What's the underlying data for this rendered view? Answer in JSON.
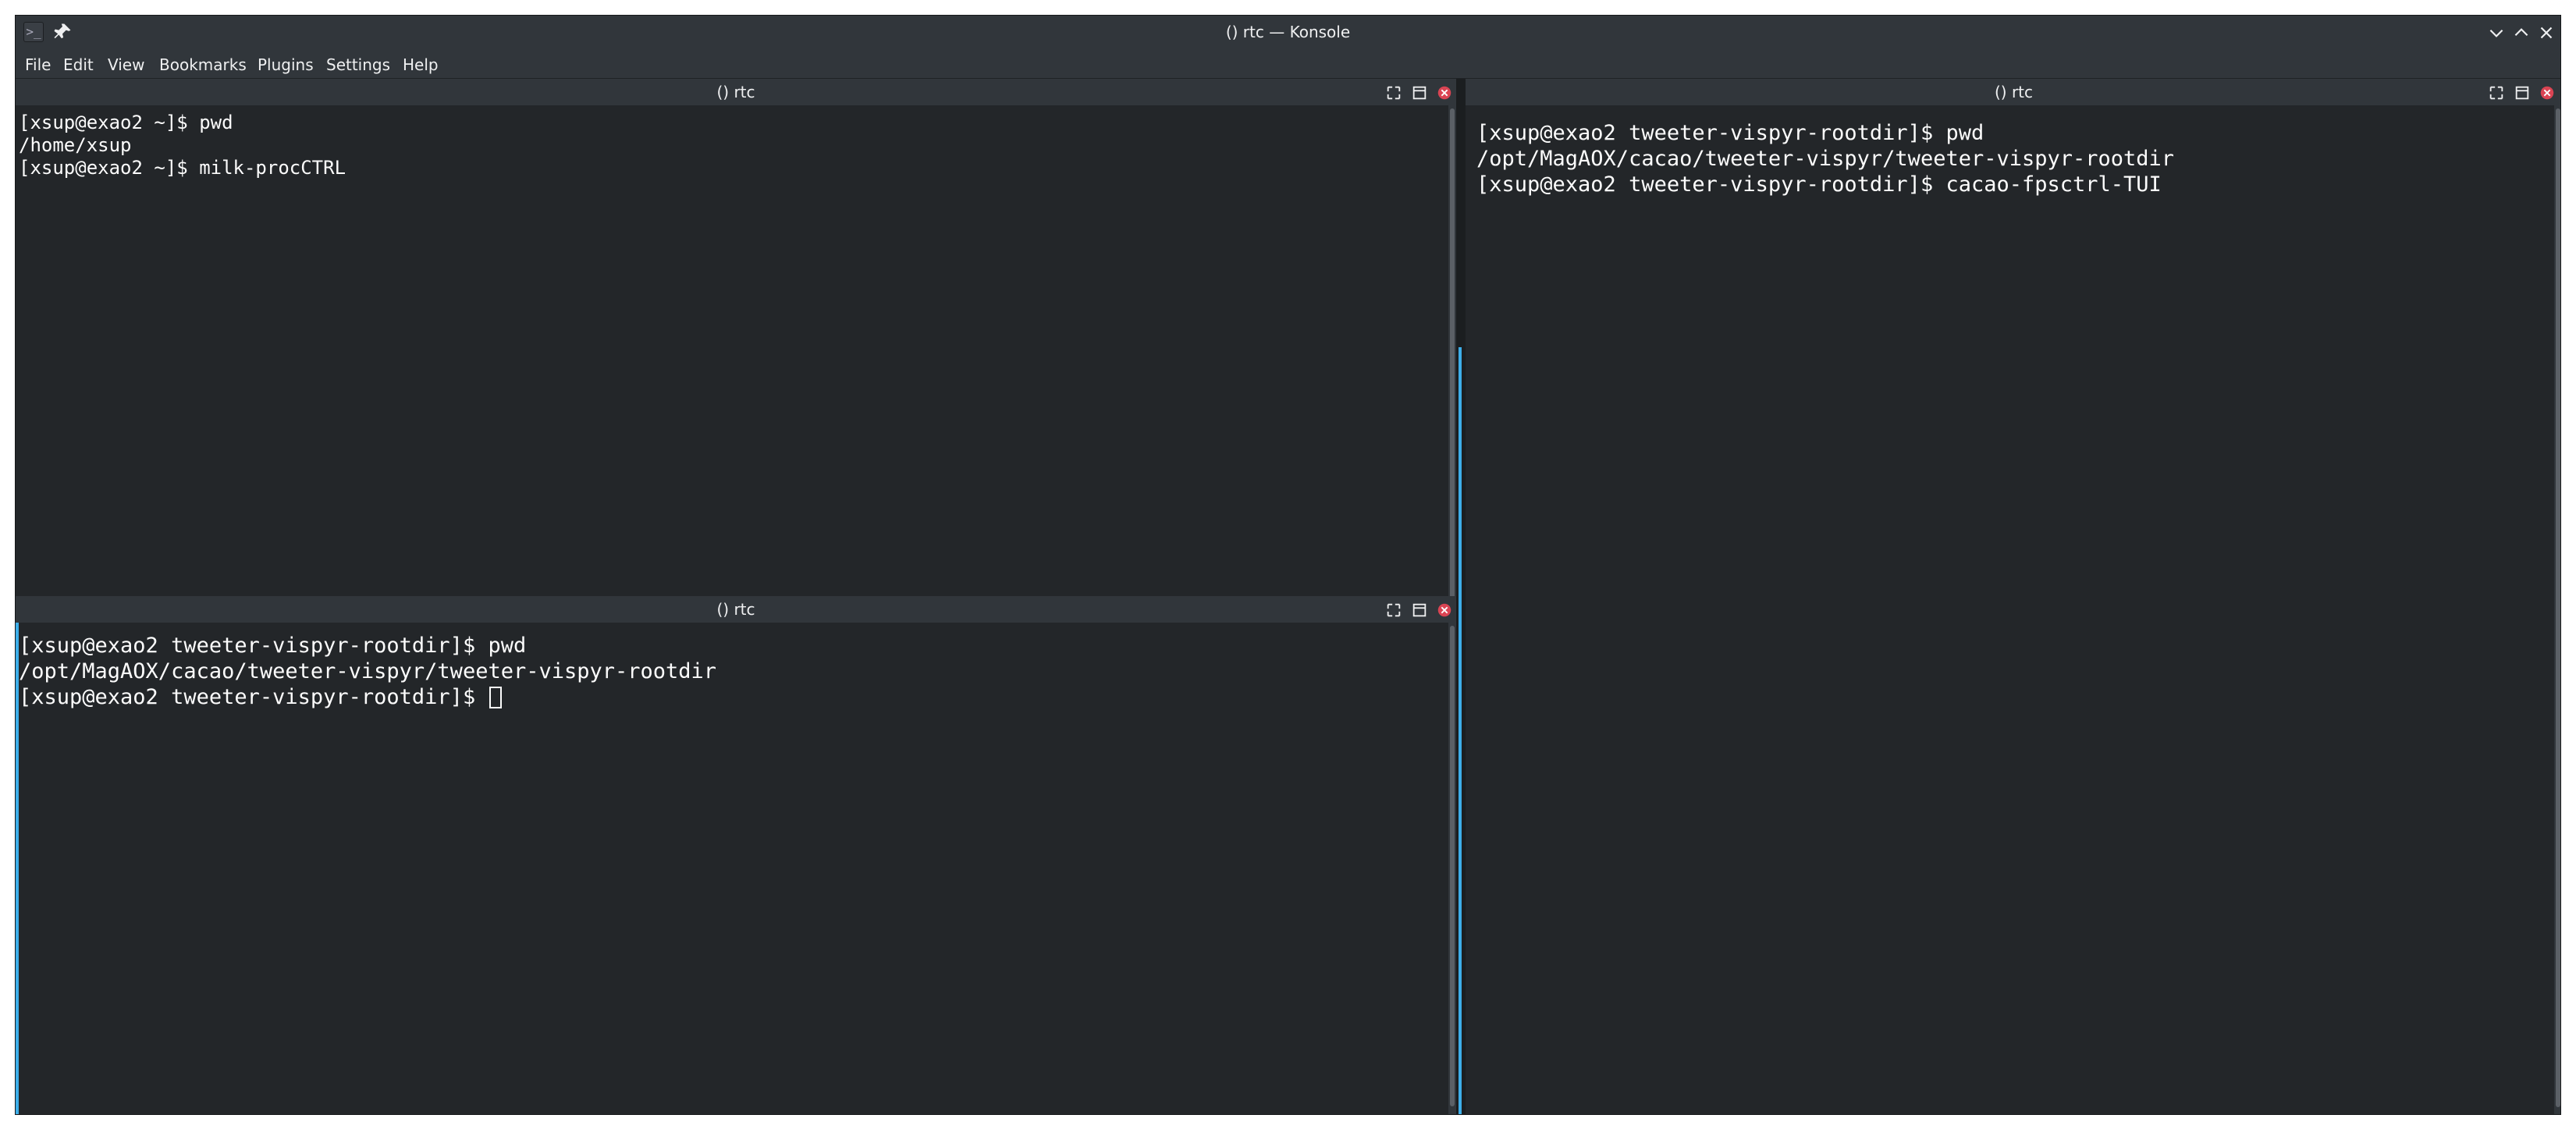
{
  "window": {
    "title": "() rtc — Konsole",
    "app_icon_glyph": ">_"
  },
  "menubar": {
    "items": [
      "File",
      "Edit",
      "View",
      "Bookmarks",
      "Plugins",
      "Settings",
      "Help"
    ]
  },
  "panes": {
    "top_left": {
      "title": "() rtc",
      "lines": [
        "[xsup@exao2 ~]$ pwd",
        "/home/xsup",
        "[xsup@exao2 ~]$ milk-procCTRL"
      ]
    },
    "bottom_left": {
      "title": "() rtc",
      "lines": [
        "[xsup@exao2 tweeter-vispyr-rootdir]$ pwd",
        "/opt/MagAOX/cacao/tweeter-vispyr/tweeter-vispyr-rootdir"
      ],
      "prompt": "[xsup@exao2 tweeter-vispyr-rootdir]$ "
    },
    "right": {
      "title": "() rtc",
      "lines": [
        "[xsup@exao2 tweeter-vispyr-rootdir]$ pwd",
        "/opt/MagAOX/cacao/tweeter-vispyr/tweeter-vispyr-rootdir",
        "[xsup@exao2 tweeter-vispyr-rootdir]$ cacao-fpsctrl-TUI"
      ]
    }
  },
  "colors": {
    "terminal_bg": "#232629",
    "chrome_bg": "#31363b",
    "text": "#fcfcfc",
    "accent": "#3daee9",
    "close_red": "#da4453"
  }
}
